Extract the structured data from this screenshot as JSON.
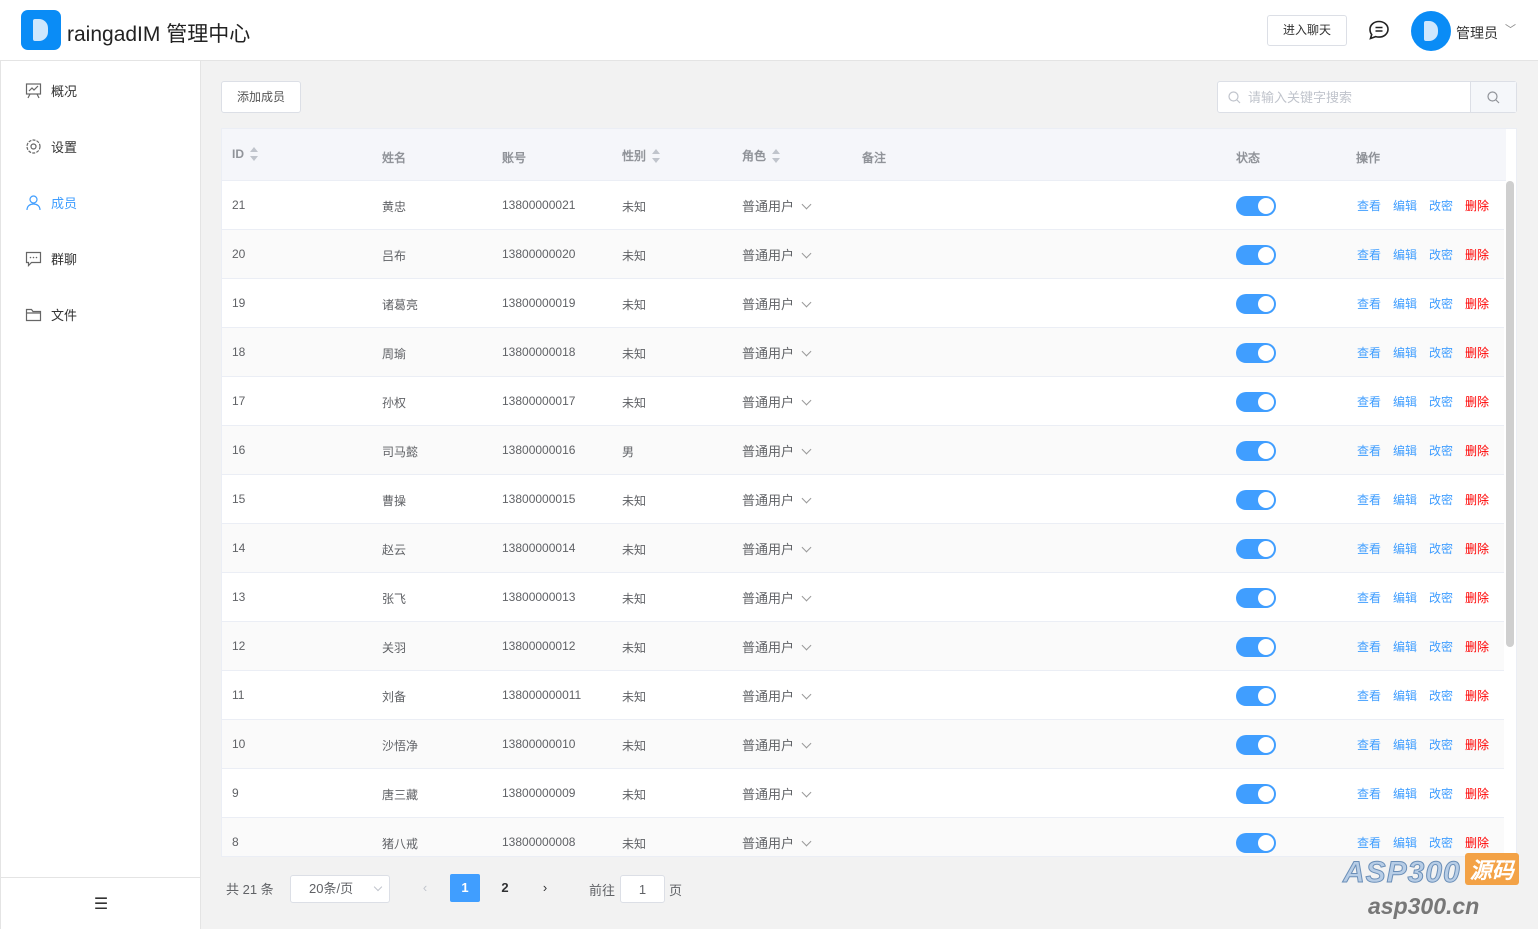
{
  "header": {
    "app_title": "raingadIM 管理中心",
    "enter_chat_label": "进入聊天",
    "admin_name": "管理员"
  },
  "sidebar": {
    "items": [
      {
        "label": "概况",
        "icon": "dashboard-icon"
      },
      {
        "label": "设置",
        "icon": "gear-icon"
      },
      {
        "label": "成员",
        "icon": "user-icon",
        "active": true
      },
      {
        "label": "群聊",
        "icon": "chat-icon"
      },
      {
        "label": "文件",
        "icon": "folder-icon"
      }
    ],
    "collapse_icon": "menu-collapse-icon"
  },
  "toolbar": {
    "add_member_label": "添加成员",
    "search_placeholder": "请输入关键字搜索",
    "search_value": ""
  },
  "table": {
    "columns": [
      "ID",
      "姓名",
      "账号",
      "性别",
      "角色",
      "备注",
      "状态",
      "操作"
    ],
    "actions": {
      "view": "查看",
      "edit": "编辑",
      "password": "改密",
      "delete": "删除"
    },
    "rows": [
      {
        "id": "21",
        "name": "黄忠",
        "account": "13800000021",
        "gender": "未知",
        "role": "普通用户",
        "note": "",
        "enabled": true
      },
      {
        "id": "20",
        "name": "吕布",
        "account": "13800000020",
        "gender": "未知",
        "role": "普通用户",
        "note": "",
        "enabled": true
      },
      {
        "id": "19",
        "name": "诸葛亮",
        "account": "13800000019",
        "gender": "未知",
        "role": "普通用户",
        "note": "",
        "enabled": true
      },
      {
        "id": "18",
        "name": "周瑜",
        "account": "13800000018",
        "gender": "未知",
        "role": "普通用户",
        "note": "",
        "enabled": true
      },
      {
        "id": "17",
        "name": "孙权",
        "account": "13800000017",
        "gender": "未知",
        "role": "普通用户",
        "note": "",
        "enabled": true
      },
      {
        "id": "16",
        "name": "司马懿",
        "account": "13800000016",
        "gender": "男",
        "role": "普通用户",
        "note": "",
        "enabled": true
      },
      {
        "id": "15",
        "name": "曹操",
        "account": "13800000015",
        "gender": "未知",
        "role": "普通用户",
        "note": "",
        "enabled": true
      },
      {
        "id": "14",
        "name": "赵云",
        "account": "13800000014",
        "gender": "未知",
        "role": "普通用户",
        "note": "",
        "enabled": true
      },
      {
        "id": "13",
        "name": "张飞",
        "account": "13800000013",
        "gender": "未知",
        "role": "普通用户",
        "note": "",
        "enabled": true
      },
      {
        "id": "12",
        "name": "关羽",
        "account": "13800000012",
        "gender": "未知",
        "role": "普通用户",
        "note": "",
        "enabled": true
      },
      {
        "id": "11",
        "name": "刘备",
        "account": "138000000011",
        "gender": "未知",
        "role": "普通用户",
        "note": "",
        "enabled": true
      },
      {
        "id": "10",
        "name": "沙悟净",
        "account": "13800000010",
        "gender": "未知",
        "role": "普通用户",
        "note": "",
        "enabled": true
      },
      {
        "id": "9",
        "name": "唐三藏",
        "account": "13800000009",
        "gender": "未知",
        "role": "普通用户",
        "note": "",
        "enabled": true
      },
      {
        "id": "8",
        "name": "猪八戒",
        "account": "13800000008",
        "gender": "未知",
        "role": "普通用户",
        "note": "",
        "enabled": true
      }
    ]
  },
  "pagination": {
    "total_label": "共 21 条",
    "page_size": "20条/页",
    "pages": [
      "1",
      "2"
    ],
    "current_page": "1",
    "goto_label": "前往",
    "goto_value": "1",
    "page_suffix": "页"
  },
  "watermark": {
    "brand": "ASP300",
    "tag": "源码",
    "url": "asp300.cn"
  },
  "colors": {
    "accent": "#409eff",
    "danger": "#ff0000",
    "logo": "#0a8cf6"
  }
}
